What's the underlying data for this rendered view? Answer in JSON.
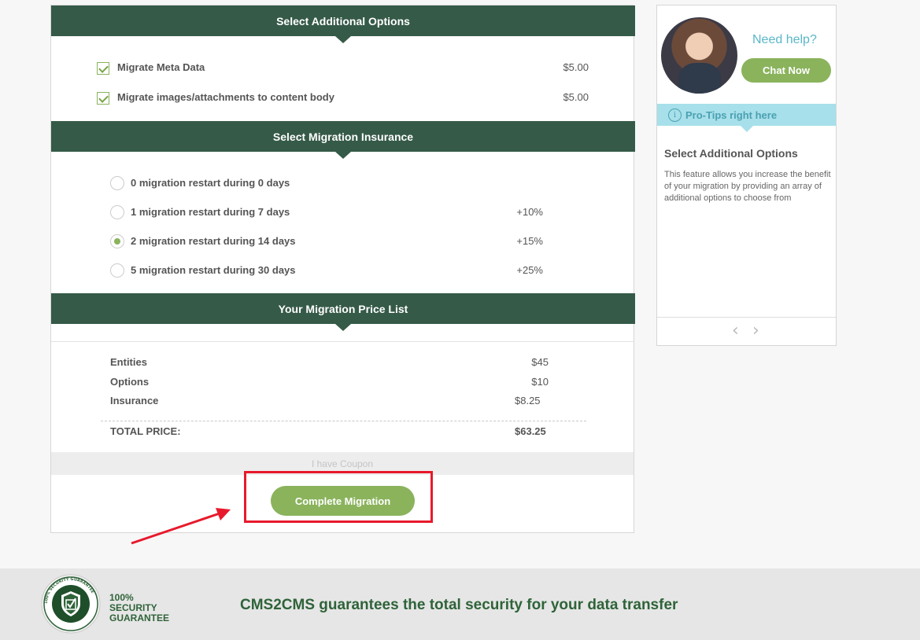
{
  "main": {
    "additional_options": {
      "header": "Select Additional Options",
      "items": [
        {
          "label": "Migrate Meta Data",
          "price": "$5.00",
          "checked": true
        },
        {
          "label": "Migrate images/attachments to content body",
          "price": "$5.00",
          "checked": true
        }
      ]
    },
    "insurance": {
      "header": "Select Migration Insurance",
      "options": [
        {
          "label": "0 migration restart during 0 days",
          "price": "",
          "selected": false
        },
        {
          "label": "1 migration restart during 7 days",
          "price": "+10%",
          "selected": false
        },
        {
          "label": "2 migration restart during 14 days",
          "price": "+15%",
          "selected": true
        },
        {
          "label": "5 migration restart during 30 days",
          "price": "+25%",
          "selected": false
        }
      ]
    },
    "price_list": {
      "header": "Your Migration Price List",
      "rows": [
        {
          "label": "Entities",
          "value": "$45"
        },
        {
          "label": "Options",
          "value": "$10"
        },
        {
          "label": "Insurance",
          "value": "$8.25"
        }
      ],
      "total_label": "TOTAL PRICE:",
      "total_value": "$63.25"
    },
    "coupon_label": "I have Coupon",
    "complete_button": "Complete Migration"
  },
  "sidebar": {
    "need_help": "Need help?",
    "chat_button": "Chat Now",
    "protips_label": "Pro-Tips right here",
    "info_glyph": "i",
    "tip_title": "Select Additional Options",
    "tip_text": "This feature allows you increase the benefit of your migration by providing an array of additional options to choose from",
    "prev_glyph": "‹",
    "next_glyph": "›"
  },
  "footer": {
    "badge_line1": "100%",
    "badge_line2": "SECURITY",
    "badge_line3": "GUARANTEE",
    "badge_ring_text": "100% SECURITY GUARANTEE",
    "text": "CMS2CMS guarantees the total security for your data transfer"
  },
  "colors": {
    "header_green": "#355a48",
    "button_green": "#8ab35c",
    "highlight_red": "#e8192c",
    "protips_blue": "#a7e0ea"
  }
}
